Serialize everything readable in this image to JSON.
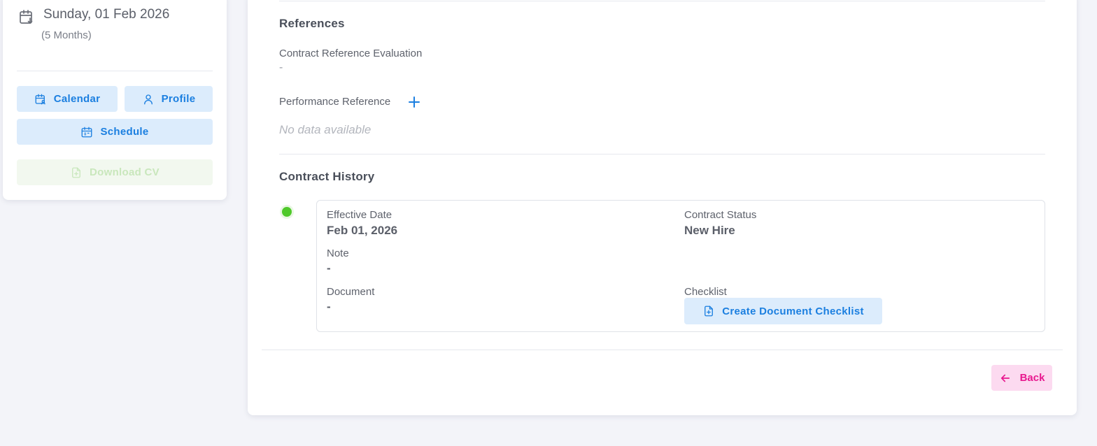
{
  "left_panel": {
    "date": "Sunday, 01 Feb 2026",
    "duration": "(5 Months)",
    "buttons": {
      "calendar": "Calendar",
      "profile": "Profile",
      "schedule": "Schedule",
      "download_cv": "Download CV"
    }
  },
  "references": {
    "title": "References",
    "contract_reference_label": "Contract Reference Evaluation",
    "contract_reference_value": "-",
    "performance_reference_label": "Performance Reference",
    "performance_reference_empty": "No data available"
  },
  "contract_history": {
    "title": "Contract History",
    "entries": [
      {
        "effective_date_label": "Effective Date",
        "effective_date": "Feb 01, 2026",
        "status_label": "Contract Status",
        "status": "New Hire",
        "note_label": "Note",
        "note": "-",
        "document_label": "Document",
        "document": "-",
        "checklist_label": "Checklist",
        "checklist_button": "Create Document Checklist",
        "status_color": "#4fc92a"
      }
    ]
  },
  "footer": {
    "back_label": "Back"
  },
  "colors": {
    "primary": "#1b7fe0",
    "primary_bg": "#dcecfc",
    "back": "#e8198f",
    "back_bg": "#fcdaf0",
    "success": "#4fc92a"
  }
}
